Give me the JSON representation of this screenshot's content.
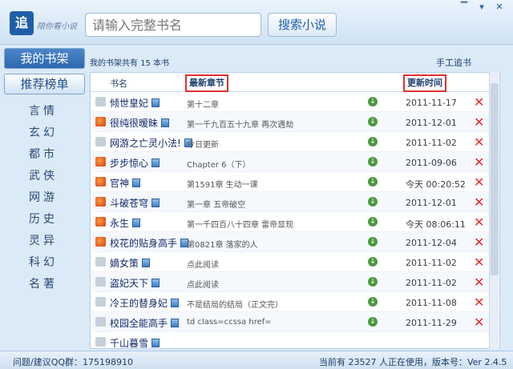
{
  "header": {
    "logo": "追",
    "slogan": "陪你看小说",
    "search_placeholder": "请输入完整书名",
    "search_button": "搜索小说",
    "window_controls": [
      "▔",
      "▾",
      "✕"
    ]
  },
  "sidebar": {
    "tabs": [
      {
        "label": "我的书架",
        "active": true
      },
      {
        "label": "推荐榜单",
        "active": false
      }
    ],
    "categories": [
      "言情",
      "玄幻",
      "都市",
      "武侠",
      "网游",
      "历史",
      "灵异",
      "科幻",
      "名著"
    ]
  },
  "shelf": {
    "count_text": "我的书架共有 15 本书",
    "manual_link": "手工追书",
    "columns": {
      "name": "书名",
      "latest": "最新章节",
      "updated": "更新时间"
    },
    "rows": [
      {
        "name": "倾世皇妃",
        "chapter": "第十二章",
        "time": "2011-11-17",
        "update": false
      },
      {
        "name": "很纯很暧昧",
        "chapter": "第一千九百五十九章 再次遇劫",
        "time": "2011-12-01",
        "update": true
      },
      {
        "name": "网游之亡灵小法!",
        "chapter": "今日更新",
        "time": "2011-11-02",
        "update": false
      },
      {
        "name": "步步惊心",
        "chapter": "Chapter 6（下）",
        "time": "2011-09-06",
        "update": true
      },
      {
        "name": "官神",
        "chapter": "第1591章 生动一课",
        "time": "今天 00:20:52",
        "update": true
      },
      {
        "name": "斗破苍穹",
        "chapter": "第一章 五帝破空",
        "time": "2011-12-01",
        "update": true
      },
      {
        "name": "永生",
        "chapter": "第一千四百八十四章 雷帝显现",
        "time": "今天 08:06:11",
        "update": true
      },
      {
        "name": "校花的贴身高手",
        "chapter": "第0821章 落家的人",
        "time": "2011-12-04",
        "update": true
      },
      {
        "name": "嫡女策",
        "chapter": "点此阅读",
        "time": "2011-11-02",
        "update": false
      },
      {
        "name": "盗妃天下",
        "chapter": "点此阅读",
        "time": "2011-11-02",
        "update": false
      },
      {
        "name": "冷王的替身妃",
        "chapter": "不是结局的结局（正文完）",
        "time": "2011-11-08",
        "update": false
      },
      {
        "name": "校园全能高手",
        "chapter": "td class=ccssa href=",
        "time": "2011-11-29",
        "update": false
      },
      {
        "name": "千山暮雪",
        "chapter": "",
        "time": "",
        "update": false
      }
    ]
  },
  "footer": {
    "feedback": "问题/建议QQ群：175198910",
    "status": "当前有 23527 人正在使用，版本号：Ver 2.4.5"
  }
}
